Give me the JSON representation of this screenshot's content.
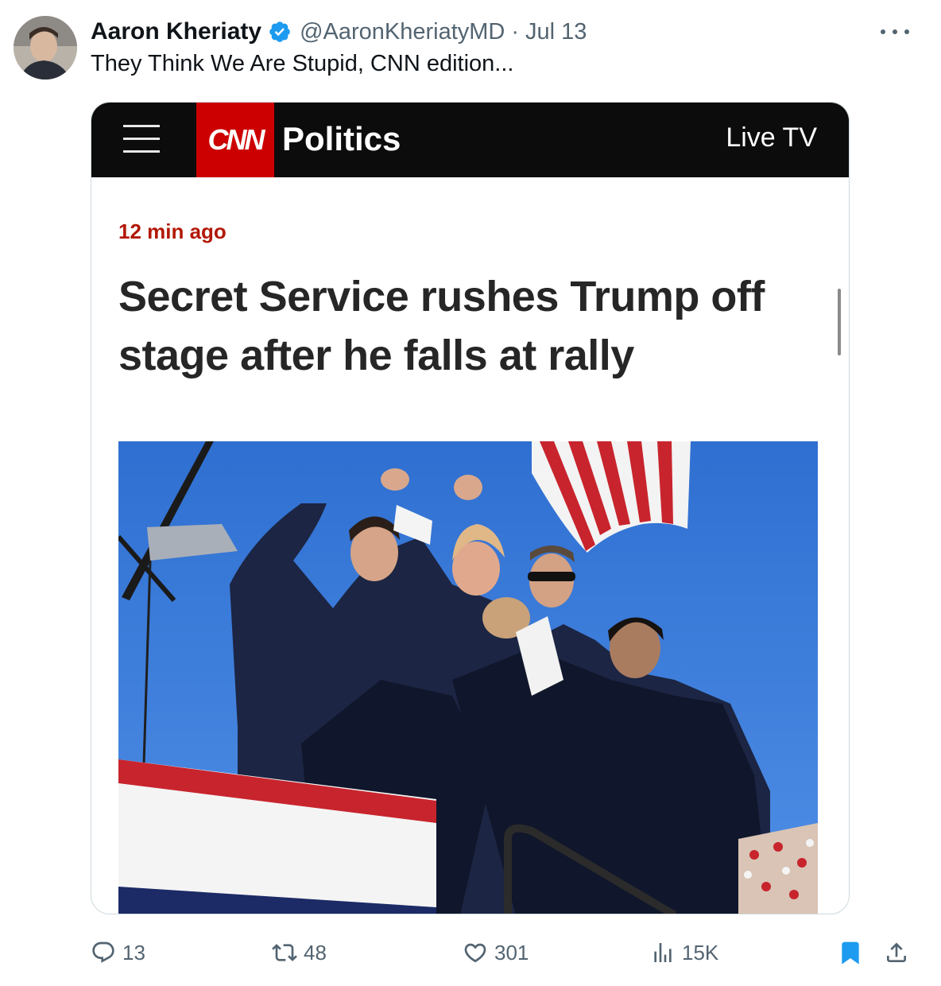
{
  "tweet": {
    "author_name": "Aaron Kheriaty",
    "handle": "@AaronKheriatyMD",
    "separator": "·",
    "date": "Jul 13",
    "text": "They Think We Are Stupid, CNN edition...",
    "verified_icon": "verified-badge-icon",
    "more_icon": "more-options-icon"
  },
  "embedded": {
    "menu_icon": "hamburger-menu-icon",
    "logo_text": "CNN",
    "section": "Politics",
    "live_tv": "Live TV",
    "timestamp": "12 min ago",
    "headline": "Secret Service rushes Trump off stage after he falls at rally"
  },
  "actions": {
    "replies": "13",
    "retweets": "48",
    "likes": "301",
    "views": "15K",
    "icons": [
      "reply-icon",
      "retweet-icon",
      "like-icon",
      "views-icon",
      "bookmark-icon",
      "share-icon"
    ]
  },
  "colors": {
    "text_primary": "#0f1419",
    "text_secondary": "#536471",
    "verified_blue": "#1d9bf0",
    "cnn_red": "#cc0000",
    "cnn_bar": "#0c0c0c",
    "timestamp_red": "#b21807",
    "bookmark_blue": "#1d9bf0"
  }
}
